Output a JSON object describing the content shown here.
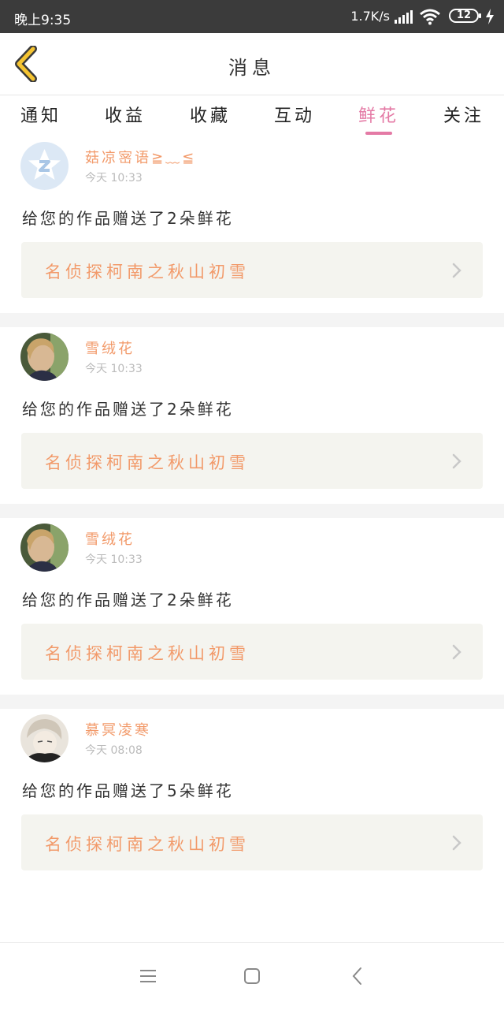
{
  "status_bar": {
    "time": "晚上9:35",
    "net_speed": "1.7K/s",
    "battery": "12"
  },
  "header": {
    "title": "消息"
  },
  "tabs": [
    {
      "label": "通知"
    },
    {
      "label": "收益"
    },
    {
      "label": "收藏"
    },
    {
      "label": "互动"
    },
    {
      "label": "鲜花",
      "active": true
    },
    {
      "label": "关注"
    }
  ],
  "feed": [
    {
      "username": "菇凉宻语≧﹏≦",
      "time": "今天 10:33",
      "message": "给您的作品赠送了2朵鲜花",
      "work_title": "名侦探柯南之秋山初雪"
    },
    {
      "username": "雪绒花",
      "time": "今天 10:33",
      "message": "给您的作品赠送了2朵鲜花",
      "work_title": "名侦探柯南之秋山初雪"
    },
    {
      "username": "雪绒花",
      "time": "今天 10:33",
      "message": "给您的作品赠送了2朵鲜花",
      "work_title": "名侦探柯南之秋山初雪"
    },
    {
      "username": "慕冥凌寒",
      "time": "今天 08:08",
      "message": "给您的作品赠送了5朵鲜花",
      "work_title": "名侦探柯南之秋山初雪"
    }
  ],
  "colors": {
    "accent": "#e47aa5",
    "name_orange": "#f29a6a",
    "work_bg": "#f4f4ef",
    "back_arrow": "#f5c431"
  }
}
